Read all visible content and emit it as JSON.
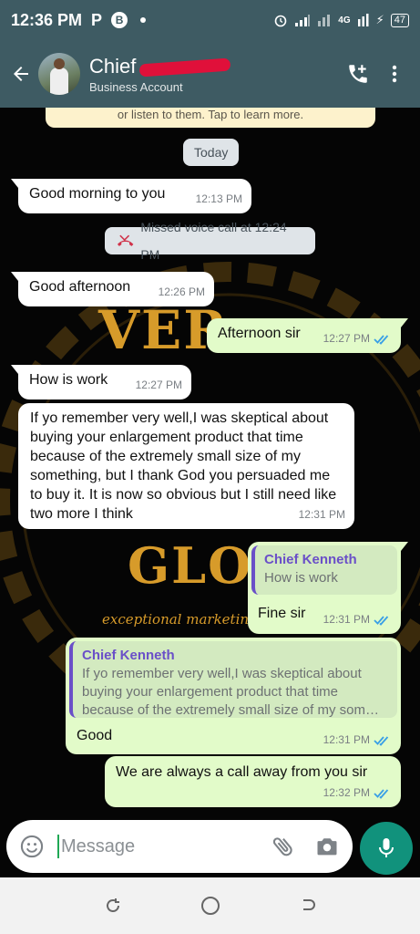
{
  "status_bar": {
    "time": "12:36 PM",
    "left_icons": [
      "P",
      "B"
    ],
    "network": "4G",
    "battery": "47"
  },
  "header": {
    "contact_name": "Chief",
    "subtitle": "Business Account",
    "icons": [
      "back-arrow-icon",
      "add-call-icon",
      "more-vert-icon"
    ]
  },
  "encryption_note": "or listen to them. Tap to learn more.",
  "date_chip": "Today",
  "missed_call": "Missed voice call at 12:24 PM",
  "messages": [
    {
      "dir": "in",
      "text": "Good morning to you",
      "time": "12:13 PM"
    },
    {
      "dir": "in",
      "text": "Good afternoon",
      "time": "12:26 PM"
    },
    {
      "dir": "out",
      "text": "Afternoon sir",
      "time": "12:27 PM"
    },
    {
      "dir": "in",
      "text": "How is work",
      "time": "12:27 PM"
    },
    {
      "dir": "in",
      "text": "If yo remember very well,I was skeptical about buying your enlargement product that time because of the extremely small size of my something, but I thank God you persuaded me to buy it. It is now so obvious but I still need like two more I think",
      "time": "12:31 PM"
    },
    {
      "dir": "out",
      "quote_name": "Chief Kenneth",
      "quote_text": "How is work",
      "text": "Fine sir",
      "time": "12:31 PM"
    },
    {
      "dir": "out",
      "quote_name": "Chief Kenneth",
      "quote_text": "If yo remember very well,I was skeptical about buying your enlargement product that time because of the extremely small size of my som…",
      "text": "Good",
      "time": "12:31 PM"
    },
    {
      "dir": "out",
      "text": "We are always a call away from you sir",
      "time": "12:32 PM"
    }
  ],
  "watermark": {
    "top": "VER",
    "middle": "GLOB",
    "tagline": "exceptional marketing"
  },
  "input": {
    "placeholder": "Message"
  },
  "colors": {
    "header": "#3e5b63",
    "out_bubble": "#e2fbc9",
    "accent": "#11927c",
    "read_ticks": "#3aa0e6",
    "quote_name": "#6a4fc8"
  }
}
